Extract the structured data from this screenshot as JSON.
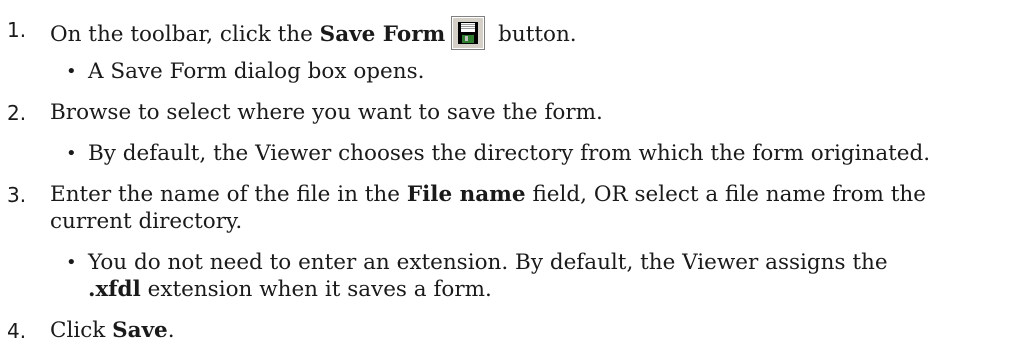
{
  "steps": [
    {
      "number": "1.",
      "pre": "On the toolbar, click the ",
      "bold": "Save Form",
      "post": " button.",
      "icon": "save-icon",
      "sub": "A Save Form dialog box opens."
    },
    {
      "number": "2.",
      "text": "Browse to select where you want to save the form.",
      "sub": "By default, the Viewer chooses the directory from which the form originated."
    },
    {
      "number": "3.",
      "pre": "Enter the name of the file in the ",
      "bold": "File name",
      "post": " field, OR select a file name from the",
      "cont": "current directory.",
      "sub": "You do not need to enter an extension. By default, the Viewer assigns the",
      "sub_bold": ".xfdl",
      "sub_post": " extension when it saves a form."
    },
    {
      "number": "4.",
      "pre": "Click ",
      "bold": "Save",
      "post": "."
    }
  ],
  "bullet_char": "•",
  "colors": {
    "icon_frame": "#7f7f7f",
    "icon_face": "#2f7d2f",
    "icon_label": "#ffffff",
    "text": "#1a1a1a"
  }
}
